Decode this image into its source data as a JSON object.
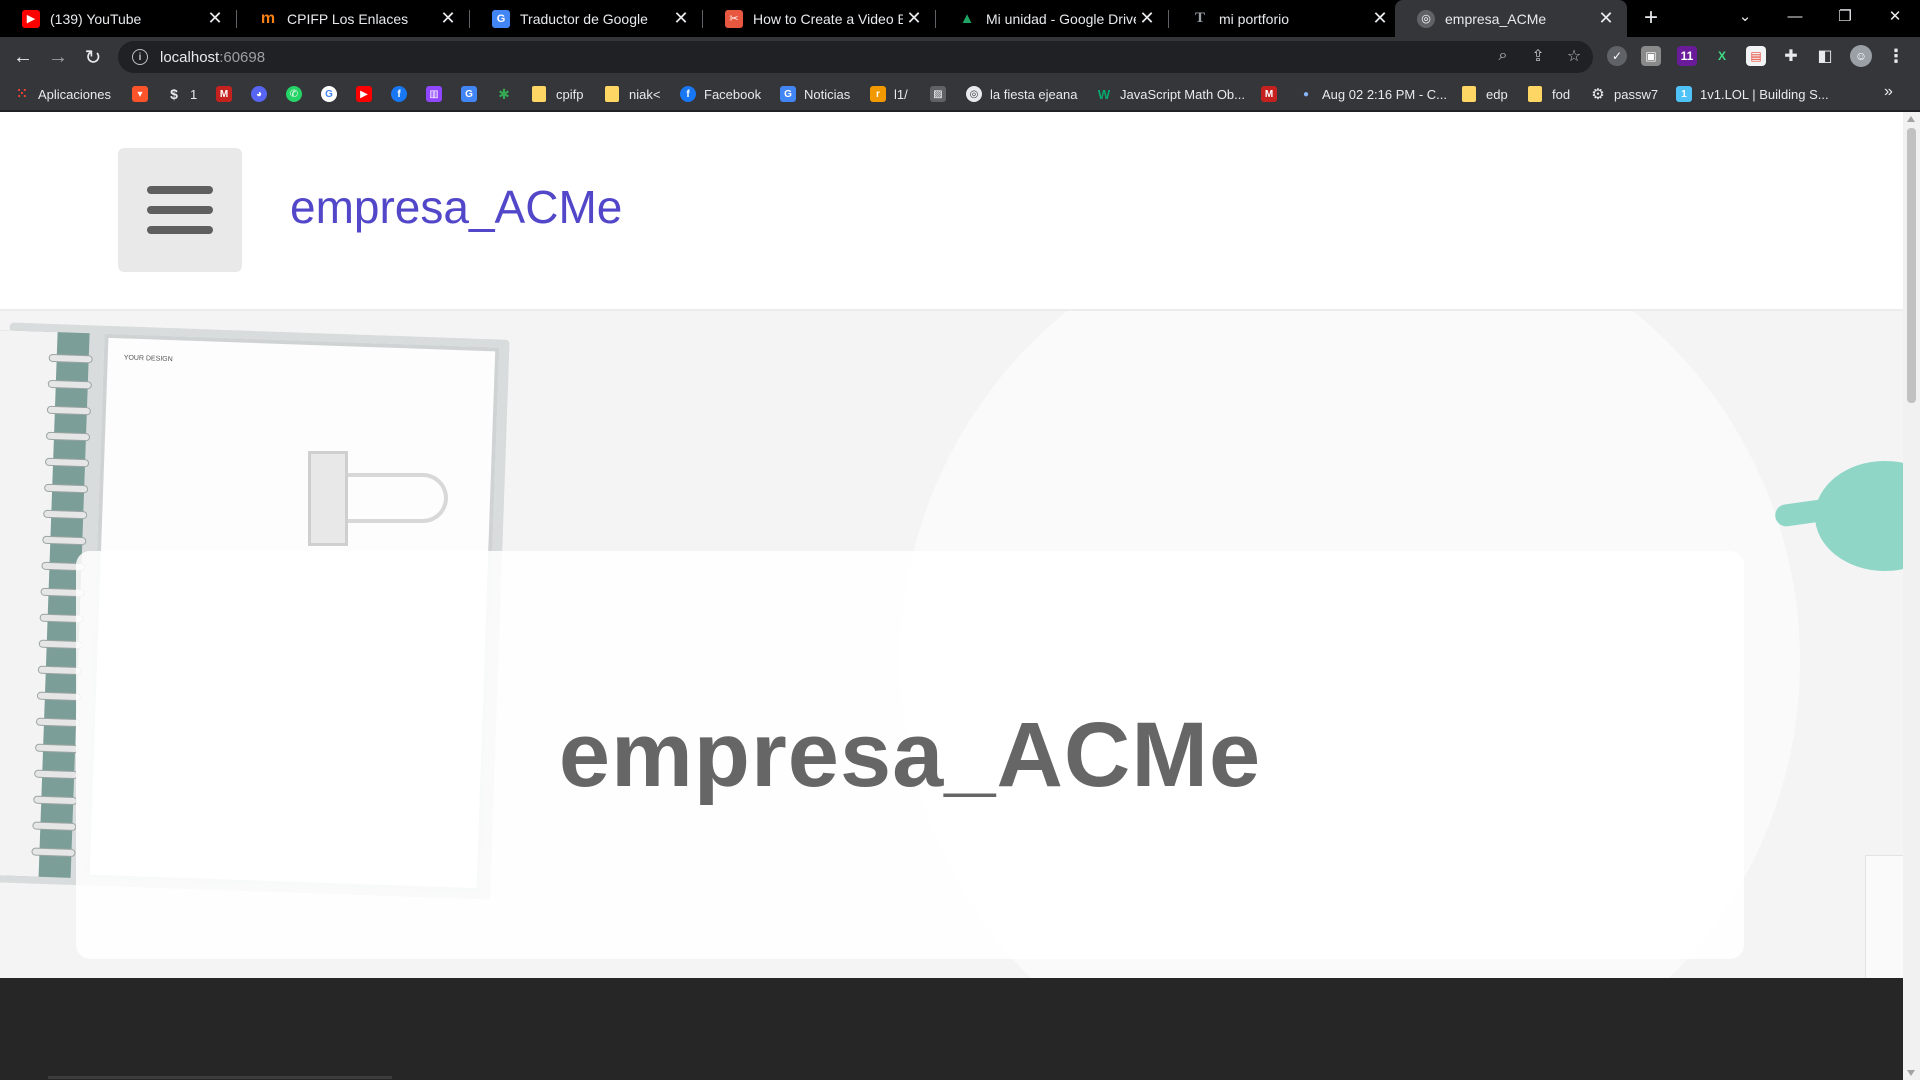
{
  "tabs": [
    {
      "title": "(139) YouTube",
      "favicon": "youtube-icon",
      "color": "#ff0000",
      "glyph": "▶"
    },
    {
      "title": "CPIFP Los Enlaces",
      "favicon": "moodle-icon",
      "color": "#f98012",
      "glyph": "m"
    },
    {
      "title": "Traductor de Google",
      "favicon": "google-translate-icon",
      "color": "#4285f4",
      "glyph": "G"
    },
    {
      "title": "How to Create a Video Back",
      "favicon": "freecodecamp-icon",
      "color": "#e8573f",
      "glyph": "✂"
    },
    {
      "title": "Mi unidad - Google Drive",
      "favicon": "google-drive-icon",
      "color": "#1fa463",
      "glyph": "▲"
    },
    {
      "title": "mi portforio",
      "favicon": "typedream-icon",
      "color": "#3c4043",
      "glyph": "T"
    },
    {
      "title": "empresa_ACMe",
      "favicon": "globe-icon",
      "color": "#5f6368",
      "glyph": "◎",
      "active": true
    }
  ],
  "address": {
    "host": "localhost",
    "port": ":60698"
  },
  "bookmarks": [
    {
      "label": "Aplicaciones",
      "icon": "apps-grid-icon",
      "color": "#ea4335"
    },
    {
      "label": "",
      "icon": "brave-icon",
      "color": "#fb542b"
    },
    {
      "label": "1",
      "icon": "s-logo-icon",
      "color": "#3c4043"
    },
    {
      "label": "",
      "icon": "gmail-icon",
      "color": "#c5221f"
    },
    {
      "label": "",
      "icon": "discord-icon",
      "color": "#5865f2"
    },
    {
      "label": "",
      "icon": "whatsapp-icon",
      "color": "#25d366"
    },
    {
      "label": "",
      "icon": "google-icon",
      "color": "#4285f4"
    },
    {
      "label": "",
      "icon": "youtube-icon",
      "color": "#ff0000"
    },
    {
      "label": "",
      "icon": "facebook-icon",
      "color": "#1877f2"
    },
    {
      "label": "",
      "icon": "twitch-icon",
      "color": "#9146ff"
    },
    {
      "label": "",
      "icon": "google-translate-icon",
      "color": "#4285f4"
    },
    {
      "label": "",
      "icon": "pinwheel-icon",
      "color": "#34a853"
    },
    {
      "label": "cpifp",
      "icon": "folder-icon"
    },
    {
      "label": "niak<",
      "icon": "folder-icon"
    },
    {
      "label": "Facebook",
      "icon": "facebook-icon",
      "color": "#1877f2"
    },
    {
      "label": "Noticias",
      "icon": "google-news-icon",
      "color": "#4285f4"
    },
    {
      "label": "l1/",
      "icon": "rtve-icon",
      "color": "#f29900"
    },
    {
      "label": "",
      "icon": "image-icon",
      "color": "#5f6368"
    },
    {
      "label": "la fiesta ejeana",
      "icon": "globe-icon",
      "color": "#5f6368"
    },
    {
      "label": "JavaScript Math Ob...",
      "icon": "w3schools-icon",
      "color": "#04aa6d"
    },
    {
      "label": "",
      "icon": "gmail-icon",
      "color": "#c5221f"
    },
    {
      "label": "Aug 02 2:16 PM - C...",
      "icon": "dot-icon",
      "color": "#8ab4f8"
    },
    {
      "label": "edp",
      "icon": "folder-icon"
    },
    {
      "label": "fod",
      "icon": "folder-icon"
    },
    {
      "label": "passw7",
      "icon": "gear-icon",
      "color": "#5f6368"
    },
    {
      "label": "1v1.LOL | Building S...",
      "icon": "1v1lol-icon",
      "color": "#4fc3f7"
    }
  ],
  "site": {
    "brand": "empresa_ACMe",
    "hero_title": "empresa_ACMe",
    "notebook_text": "YOUR DESIGN"
  },
  "colors": {
    "brand": "#5247c9",
    "hero_text": "#666666",
    "footer": "#262626"
  }
}
